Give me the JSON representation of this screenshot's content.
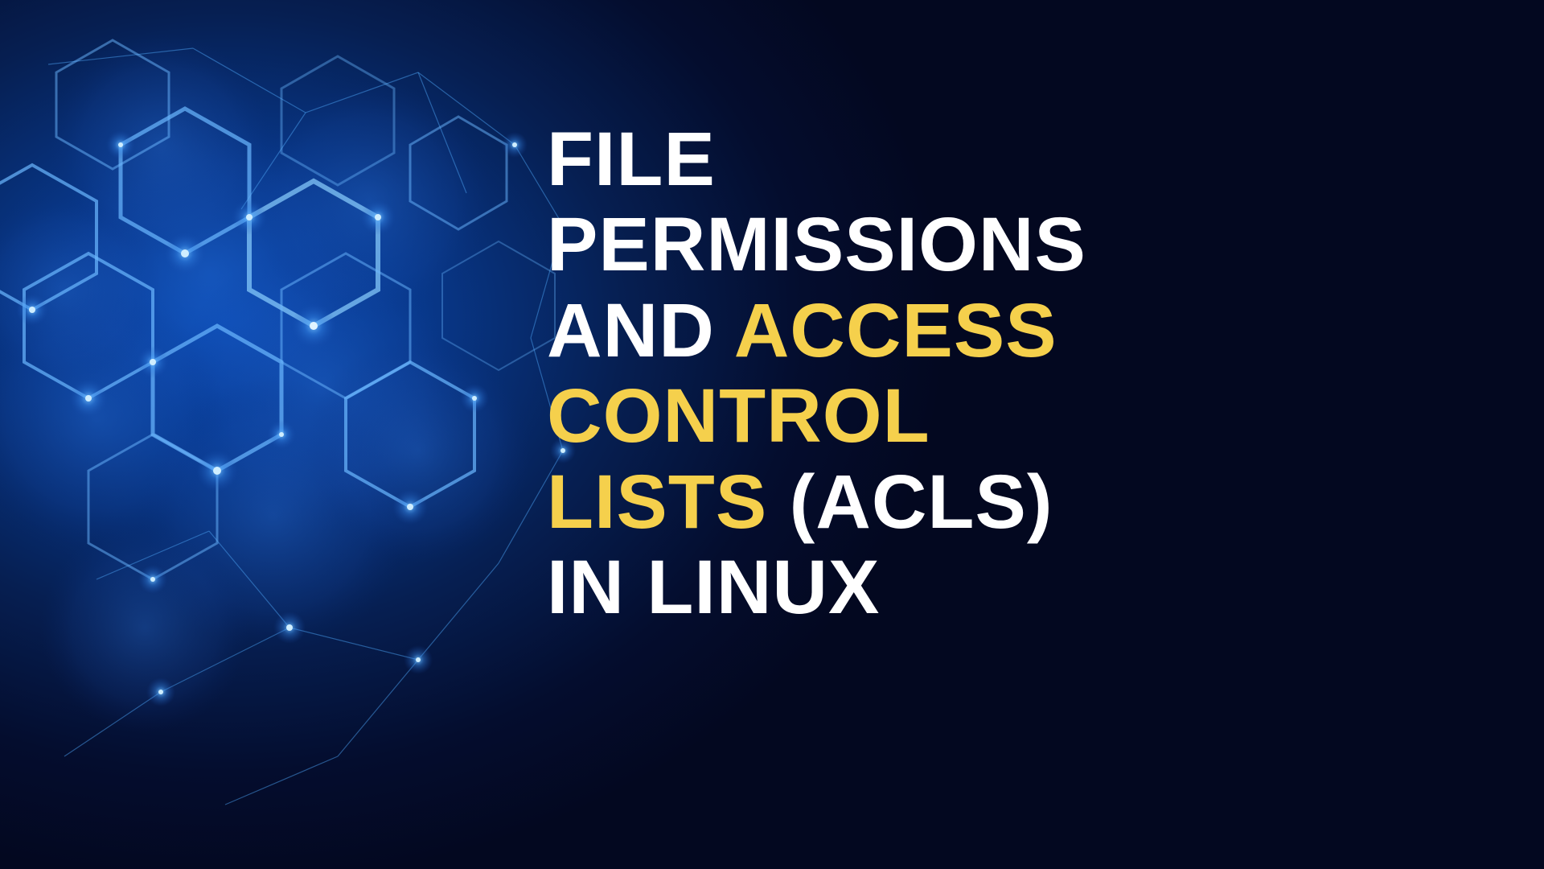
{
  "title": {
    "line1": "FILE",
    "line2": "PERMISSIONS",
    "line3a": "AND ",
    "line3b": "ACCESS",
    "line4": "CONTROL",
    "line5": "LISTS",
    "line5b": " (ACLS)",
    "line6": "IN LINUX"
  },
  "colors": {
    "highlight": "#f5d04c",
    "text": "#ffffff",
    "bg_dark": "#030820",
    "bg_light": "#0a4db8"
  }
}
